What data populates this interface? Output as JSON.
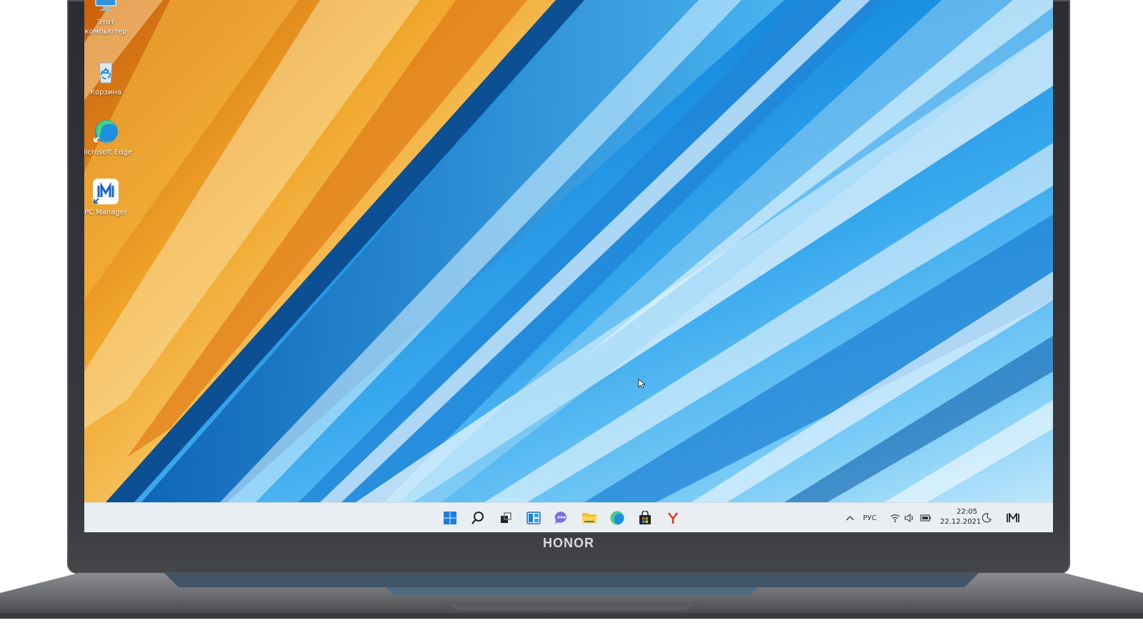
{
  "desktop": {
    "icons": [
      {
        "label": "Этот компьютер",
        "icon": "this-pc-icon"
      },
      {
        "label": "Корзина",
        "icon": "recycle-bin-icon"
      },
      {
        "label": "Microsoft Edge",
        "icon": "edge-icon"
      },
      {
        "label": "PC Manager",
        "icon": "pc-manager-icon"
      }
    ]
  },
  "taskbar": {
    "pinned": [
      "start-icon",
      "search-icon",
      "task-view-icon",
      "widgets-icon",
      "chat-icon",
      "file-explorer-icon",
      "edge-icon",
      "store-icon",
      "yandex-browser-icon"
    ],
    "tray": {
      "language": "РУС",
      "time": "22:05",
      "date": "22.12.2021"
    }
  },
  "device": {
    "brand": "HONOR"
  },
  "colors": {
    "taskbar_bg": "#e9eef3",
    "wallpaper_blue": "#1a8ee0",
    "wallpaper_orange": "#e98a1f",
    "lid": "#2c2d31"
  }
}
